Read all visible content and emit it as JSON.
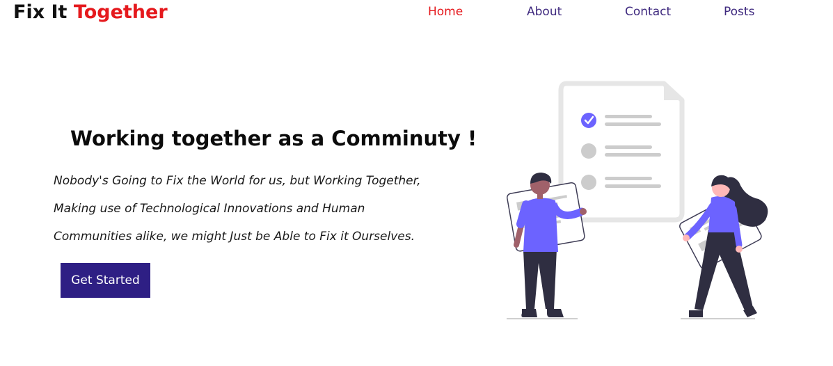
{
  "header": {
    "logo_part1": "Fix It ",
    "logo_part2": "Together",
    "nav": [
      {
        "label": "Home",
        "active": true
      },
      {
        "label": "About",
        "active": false
      },
      {
        "label": "Contact",
        "active": false
      },
      {
        "label": "Posts",
        "active": false
      }
    ]
  },
  "hero": {
    "title": "Working together as a Comminuty !",
    "lines": [
      "Nobody's Going to Fix the World for us, but Working Together,",
      "Making use of Technological Innovations and Human",
      "Communities alike, we might Just be Able to Fix it Ourselves."
    ],
    "cta_label": "Get Started"
  },
  "colors": {
    "accent_red": "#e5191d",
    "nav_purple": "#3f2a7f",
    "button_bg": "#2e1f84",
    "illustration_purple": "#6c63ff"
  }
}
